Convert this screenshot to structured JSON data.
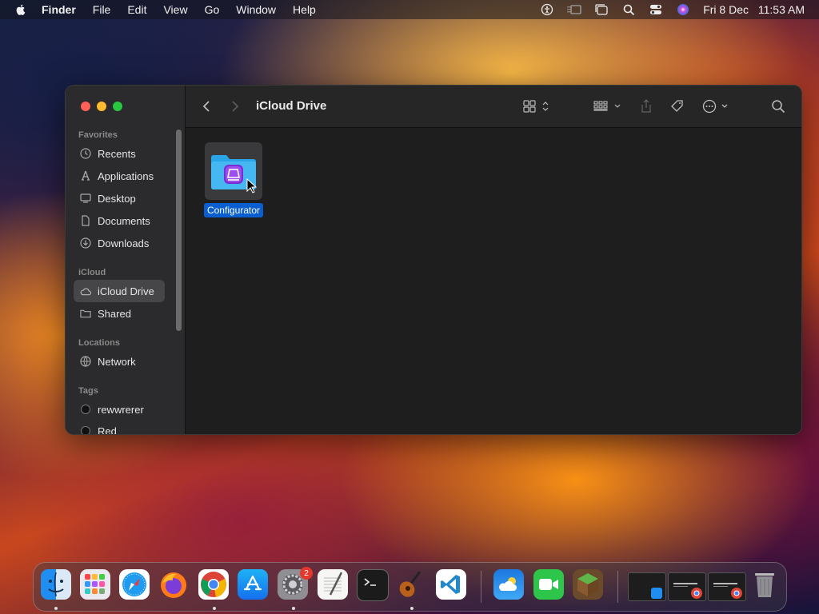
{
  "menubar": {
    "app_name": "Finder",
    "menus": [
      "File",
      "Edit",
      "View",
      "Go",
      "Window",
      "Help"
    ],
    "date": "Fri 8 Dec",
    "time": "11:53 AM"
  },
  "window": {
    "title": "iCloud Drive",
    "sidebar": {
      "favorites_header": "Favorites",
      "favorites": [
        {
          "label": "Recents",
          "icon": "clock-icon"
        },
        {
          "label": "Applications",
          "icon": "applications-icon"
        },
        {
          "label": "Desktop",
          "icon": "desktop-icon"
        },
        {
          "label": "Documents",
          "icon": "document-icon"
        },
        {
          "label": "Downloads",
          "icon": "download-icon"
        }
      ],
      "icloud_header": "iCloud",
      "icloud": [
        {
          "label": "iCloud Drive",
          "icon": "cloud-icon",
          "selected": true
        },
        {
          "label": "Shared",
          "icon": "shared-folder-icon"
        }
      ],
      "locations_header": "Locations",
      "locations": [
        {
          "label": "Network",
          "icon": "globe-icon"
        }
      ],
      "tags_header": "Tags",
      "tags": [
        {
          "label": "rewwrerer",
          "color": "#111111"
        },
        {
          "label": "Red",
          "color": "#111111"
        }
      ]
    },
    "files": [
      {
        "name": "Configurator",
        "icon": "folder-icon",
        "selected": true
      }
    ]
  },
  "dock": {
    "apps": [
      "Finder",
      "Launchpad",
      "Safari",
      "Firefox",
      "Chrome",
      "App Store",
      "System Settings",
      "TextEdit",
      "Terminal",
      "GarageBand",
      "Visual Studio Code",
      "Weather",
      "FaceTime",
      "Minecraft"
    ],
    "system_settings_badge": "2",
    "colors": {
      "accent": "#0a5fd0",
      "badge": "#e5372b"
    }
  }
}
